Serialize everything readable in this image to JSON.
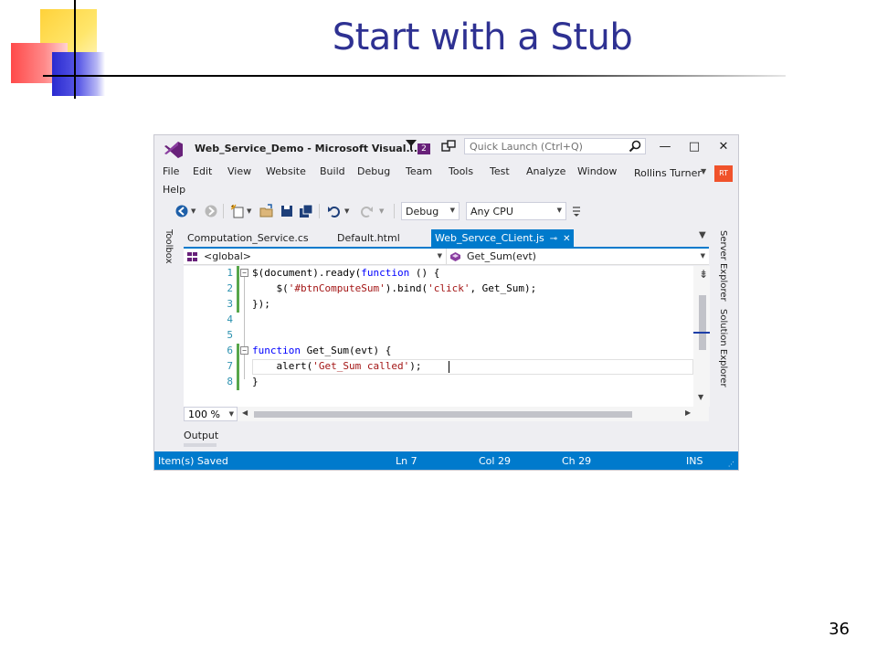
{
  "slide": {
    "title": "Start with a Stub",
    "page_number": "36"
  },
  "window": {
    "title": "Web_Service_Demo - Microsoft Visual...",
    "notification_count": "2",
    "quick_launch_placeholder": "Quick Launch (Ctrl+Q)",
    "controls": [
      "—",
      "□",
      "✕"
    ]
  },
  "menu": {
    "items": [
      "File",
      "Edit",
      "View",
      "Website",
      "Build",
      "Debug",
      "Team",
      "Tools",
      "Test",
      "Analyze",
      "Window",
      "Help"
    ],
    "user": "Rollins Turner",
    "avatar": "RT"
  },
  "toolbar": {
    "configuration": "Debug",
    "platform": "Any CPU"
  },
  "side_panels": {
    "left": "Toolbox",
    "right": [
      "Server Explorer",
      "Solution Explorer"
    ]
  },
  "tabs": [
    {
      "label": "Computation_Service.cs",
      "active": false
    },
    {
      "label": "Default.html",
      "active": false
    },
    {
      "label": "Web_Servce_CLient.js",
      "active": true
    }
  ],
  "nav": {
    "scope": "<global>",
    "member": "Get_Sum(evt)"
  },
  "editor": {
    "lines": [
      {
        "num": "1",
        "text": "$(document).ready(function () {"
      },
      {
        "num": "2",
        "text": "    $('#btnComputeSum').bind('click', Get_Sum);"
      },
      {
        "num": "3",
        "text": "});"
      },
      {
        "num": "4",
        "text": ""
      },
      {
        "num": "5",
        "text": ""
      },
      {
        "num": "6",
        "text": "function Get_Sum(evt) {"
      },
      {
        "num": "7",
        "text": "    alert('Get_Sum called');"
      },
      {
        "num": "8",
        "text": "}"
      }
    ],
    "zoom": "100 %"
  },
  "output_label": "Output",
  "status": {
    "message": "Item(s) Saved",
    "ln": "Ln 7",
    "col": "Col 29",
    "ch": "Ch 29",
    "mode": "INS"
  },
  "colors": {
    "accent": "#007acc",
    "title": "#2e3192",
    "keyword": "#0000ff",
    "string": "#a31515",
    "line_number": "#2b91af"
  }
}
